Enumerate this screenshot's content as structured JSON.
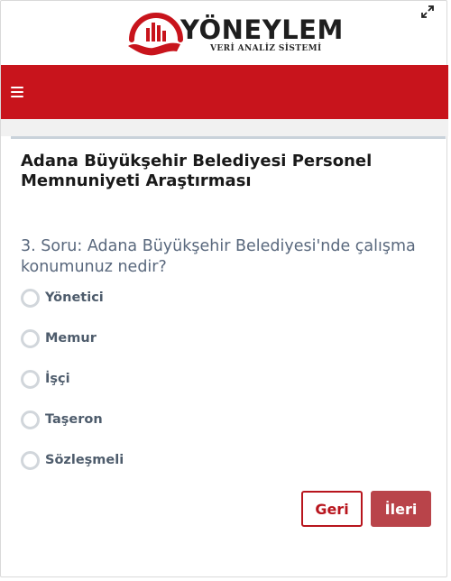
{
  "header": {
    "brand_name": "YÖNEYLEM",
    "brand_tagline": "VERİ ANALİZ SİSTEMİ",
    "expand_icon": "expand-icon"
  },
  "navbar": {
    "background": "#c8141c",
    "menu_icon": "hamburger-menu-icon"
  },
  "survey": {
    "title": "Adana Büyükşehir Belediyesi Personel Memnuniyeti Araştırması",
    "question": "3. Soru: Adana Büyükşehir Belediyesi'nde çalışma konumunuz nedir?",
    "options": [
      "Yönetici",
      "Memur",
      "İşçi",
      "Taşeron",
      "Sözleşmeli"
    ],
    "selected": null
  },
  "actions": {
    "back_label": "Geri",
    "next_label": "İleri"
  },
  "colors": {
    "accent_red": "#c8141c",
    "question_text": "#59687d",
    "next_button": "#b9444a"
  }
}
